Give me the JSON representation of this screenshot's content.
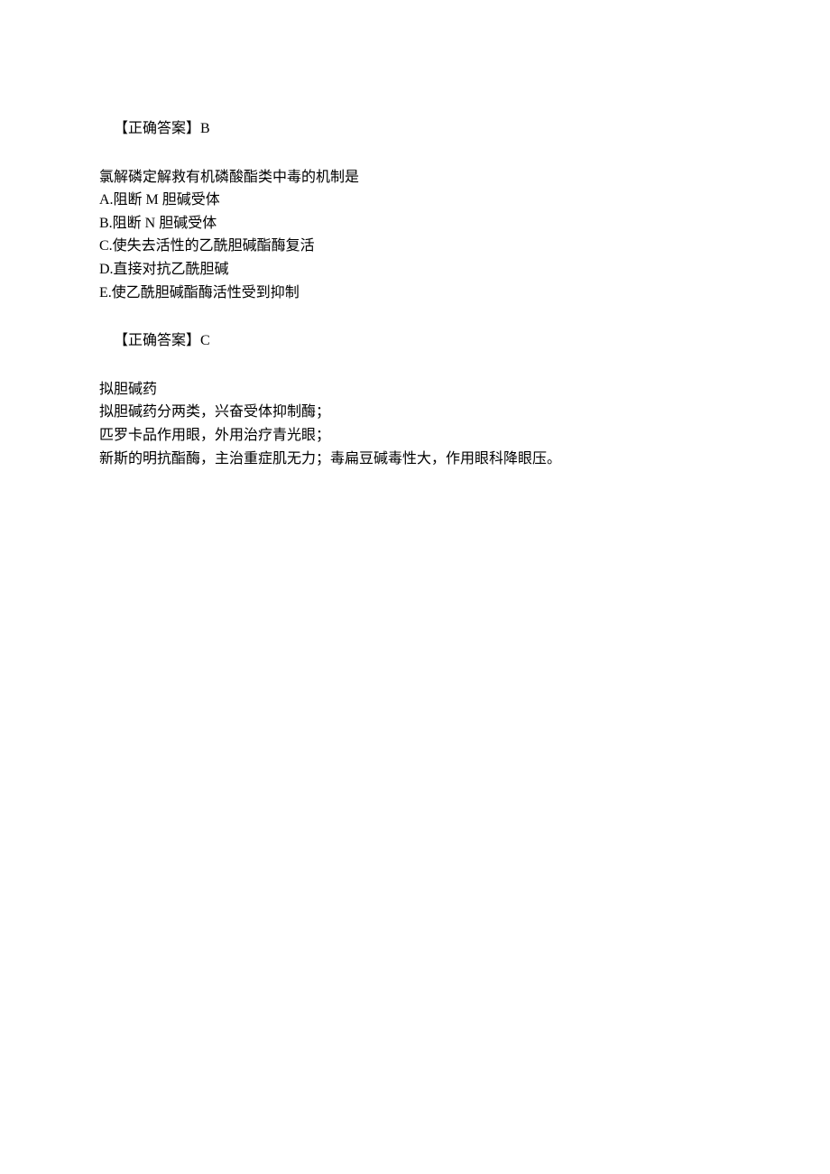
{
  "answer1": {
    "label": "【正确答案】B"
  },
  "question": {
    "stem": "氯解磷定解救有机磷酸酯类中毒的机制是",
    "options": {
      "a": "A.阻断 M 胆碱受体",
      "b": "B.阻断 N 胆碱受体",
      "c": "C.使失去活性的乙酰胆碱酯酶复活",
      "d": "D.直接对抗乙酰胆碱",
      "e": "E.使乙酰胆碱酯酶活性受到抑制"
    }
  },
  "answer2": {
    "label": "【正确答案】C"
  },
  "notes": {
    "line1": "拟胆碱药",
    "line2": "拟胆碱药分两类，兴奋受体抑制酶；",
    "line3": "匹罗卡品作用眼，外用治疗青光眼；",
    "line4": "新斯的明抗酯酶，主治重症肌无力；毒扁豆碱毒性大，作用眼科降眼压。"
  }
}
